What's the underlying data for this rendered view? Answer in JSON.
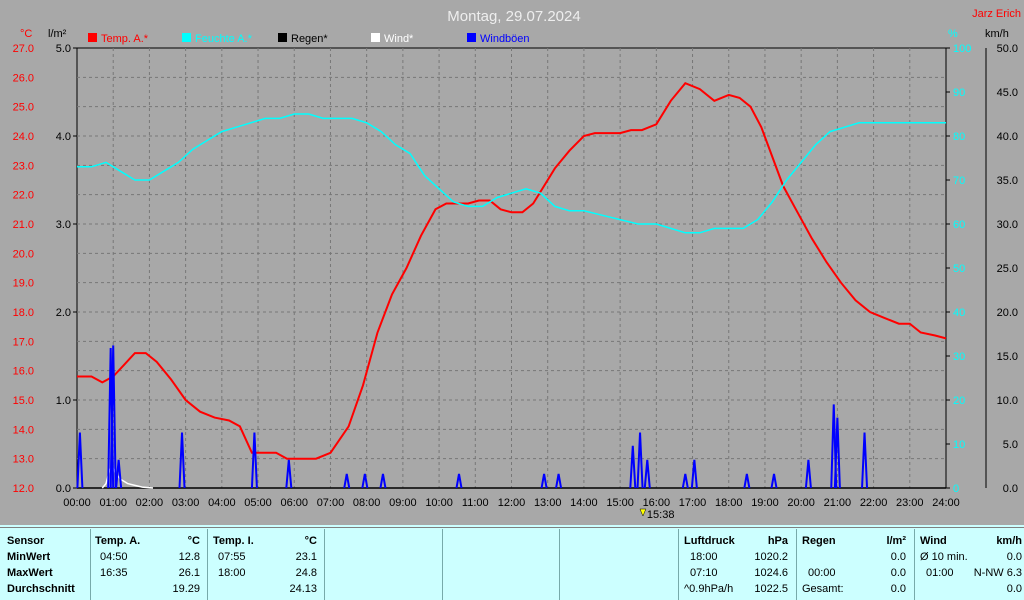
{
  "chart_data": {
    "type": "line",
    "title": "Montag, 29.07.2024",
    "brand": "Jarz Erich",
    "axes": {
      "left_temp": {
        "label": "°C",
        "range": [
          12.0,
          27.0
        ],
        "ticks": [
          "27.0",
          "26.0",
          "25.0",
          "24.0",
          "23.0",
          "22.0",
          "21.0",
          "20.0",
          "19.0",
          "18.0",
          "17.0",
          "16.0",
          "15.0",
          "14.0",
          "13.0",
          "12.0"
        ]
      },
      "left_rain": {
        "label": "l/m²",
        "range": [
          0.0,
          5.0
        ],
        "ticks": [
          "5.0",
          "4.0",
          "3.0",
          "2.0",
          "1.0",
          "0.0"
        ]
      },
      "right_hum": {
        "label": "%",
        "range": [
          0,
          100
        ],
        "ticks": [
          "100",
          "90",
          "80",
          "70",
          "60",
          "50",
          "40",
          "30",
          "20",
          "10",
          "0"
        ]
      },
      "right_wind": {
        "label": "km/h",
        "range": [
          0.0,
          50.0
        ],
        "ticks": [
          "50.0",
          "45.0",
          "40.0",
          "35.0",
          "30.0",
          "25.0",
          "20.0",
          "15.0",
          "10.0",
          "5.0",
          "0.0"
        ]
      },
      "x": {
        "range": [
          0,
          24
        ],
        "ticks": [
          "00:00",
          "01:00",
          "02:00",
          "03:00",
          "04:00",
          "05:00",
          "06:00",
          "07:00",
          "08:00",
          "09:00",
          "10:00",
          "11:00",
          "12:00",
          "13:00",
          "14:00",
          "15:00",
          "16:00",
          "17:00",
          "18:00",
          "19:00",
          "20:00",
          "21:00",
          "22:00",
          "23:00",
          "24:00"
        ]
      }
    },
    "grid": true,
    "marker": {
      "label": "15:38",
      "hour": 15.63
    },
    "legend": [
      {
        "name": "Temp. A.*",
        "color": "#ff0000"
      },
      {
        "name": "Feuchte A.*",
        "color": "#00ffff"
      },
      {
        "name": "Regen*",
        "color": "#000000"
      },
      {
        "name": "Wind*",
        "color": "#ffffff"
      },
      {
        "name": "Windböen",
        "color": "#0000ff"
      }
    ],
    "series": [
      {
        "name": "Temp. A.*",
        "color": "#ff0000",
        "axis": "left_temp",
        "points": [
          [
            0,
            15.8
          ],
          [
            0.4,
            15.8
          ],
          [
            0.7,
            15.6
          ],
          [
            1.0,
            15.8
          ],
          [
            1.3,
            16.2
          ],
          [
            1.6,
            16.6
          ],
          [
            1.9,
            16.6
          ],
          [
            2.2,
            16.3
          ],
          [
            2.6,
            15.7
          ],
          [
            3.0,
            15.0
          ],
          [
            3.4,
            14.6
          ],
          [
            3.8,
            14.4
          ],
          [
            4.2,
            14.3
          ],
          [
            4.5,
            14.1
          ],
          [
            4.83,
            13.2
          ],
          [
            5.2,
            13.2
          ],
          [
            5.5,
            13.2
          ],
          [
            5.8,
            13.0
          ],
          [
            6.2,
            13.0
          ],
          [
            6.6,
            13.0
          ],
          [
            7.0,
            13.2
          ],
          [
            7.5,
            14.1
          ],
          [
            7.9,
            15.5
          ],
          [
            8.3,
            17.3
          ],
          [
            8.7,
            18.6
          ],
          [
            9.1,
            19.5
          ],
          [
            9.5,
            20.6
          ],
          [
            9.9,
            21.5
          ],
          [
            10.2,
            21.7
          ],
          [
            10.5,
            21.7
          ],
          [
            10.8,
            21.7
          ],
          [
            11.1,
            21.8
          ],
          [
            11.4,
            21.8
          ],
          [
            11.7,
            21.5
          ],
          [
            12.0,
            21.4
          ],
          [
            12.3,
            21.4
          ],
          [
            12.6,
            21.7
          ],
          [
            12.9,
            22.3
          ],
          [
            13.2,
            22.9
          ],
          [
            13.6,
            23.5
          ],
          [
            14.0,
            24.0
          ],
          [
            14.3,
            24.1
          ],
          [
            14.6,
            24.1
          ],
          [
            15.0,
            24.1
          ],
          [
            15.3,
            24.2
          ],
          [
            15.6,
            24.2
          ],
          [
            16.0,
            24.4
          ],
          [
            16.4,
            25.2
          ],
          [
            16.8,
            25.8
          ],
          [
            17.2,
            25.6
          ],
          [
            17.6,
            25.2
          ],
          [
            18.0,
            25.4
          ],
          [
            18.3,
            25.3
          ],
          [
            18.6,
            25.0
          ],
          [
            18.9,
            24.3
          ],
          [
            19.2,
            23.3
          ],
          [
            19.5,
            22.3
          ],
          [
            19.9,
            21.4
          ],
          [
            20.3,
            20.5
          ],
          [
            20.7,
            19.7
          ],
          [
            21.1,
            19.0
          ],
          [
            21.5,
            18.4
          ],
          [
            21.9,
            18.0
          ],
          [
            22.3,
            17.8
          ],
          [
            22.7,
            17.6
          ],
          [
            23.0,
            17.6
          ],
          [
            23.3,
            17.3
          ],
          [
            23.7,
            17.2
          ],
          [
            24.0,
            17.1
          ]
        ]
      },
      {
        "name": "Feuchte A.*",
        "color": "#00ffff",
        "axis": "right_hum",
        "points": [
          [
            0,
            73
          ],
          [
            0.4,
            73
          ],
          [
            0.8,
            74
          ],
          [
            1.2,
            72
          ],
          [
            1.6,
            70
          ],
          [
            2.0,
            70
          ],
          [
            2.4,
            72
          ],
          [
            2.8,
            74
          ],
          [
            3.2,
            77
          ],
          [
            3.6,
            79
          ],
          [
            4.0,
            81
          ],
          [
            4.4,
            82
          ],
          [
            4.8,
            83
          ],
          [
            5.2,
            84
          ],
          [
            5.6,
            84
          ],
          [
            6.0,
            85
          ],
          [
            6.4,
            85
          ],
          [
            6.8,
            84
          ],
          [
            7.2,
            84
          ],
          [
            7.6,
            84
          ],
          [
            8.0,
            83
          ],
          [
            8.4,
            81
          ],
          [
            8.8,
            78
          ],
          [
            9.2,
            76
          ],
          [
            9.6,
            71
          ],
          [
            10.0,
            68
          ],
          [
            10.4,
            65
          ],
          [
            10.8,
            64
          ],
          [
            11.2,
            64
          ],
          [
            11.6,
            66
          ],
          [
            12.0,
            67
          ],
          [
            12.4,
            68
          ],
          [
            12.8,
            67
          ],
          [
            13.2,
            64
          ],
          [
            13.6,
            63
          ],
          [
            14.0,
            63
          ],
          [
            14.5,
            62
          ],
          [
            15.0,
            61
          ],
          [
            15.5,
            60
          ],
          [
            16.0,
            60
          ],
          [
            16.4,
            59
          ],
          [
            16.8,
            58
          ],
          [
            17.2,
            58
          ],
          [
            17.6,
            59
          ],
          [
            18.0,
            59
          ],
          [
            18.4,
            59
          ],
          [
            18.8,
            61
          ],
          [
            19.2,
            65
          ],
          [
            19.6,
            70
          ],
          [
            20.0,
            74
          ],
          [
            20.4,
            78
          ],
          [
            20.8,
            81
          ],
          [
            21.2,
            82
          ],
          [
            21.6,
            83
          ],
          [
            22.0,
            83
          ],
          [
            22.4,
            83
          ],
          [
            22.8,
            83
          ],
          [
            23.2,
            83
          ],
          [
            23.6,
            83
          ],
          [
            24.0,
            83
          ]
        ]
      },
      {
        "name": "Regen*",
        "color": "#000000",
        "axis": "left_rain",
        "points": [
          [
            0,
            0
          ],
          [
            24,
            0
          ]
        ]
      },
      {
        "name": "Wind*",
        "color": "#ffffff",
        "axis": "right_wind",
        "points": [
          [
            0.7,
            0
          ],
          [
            0.8,
            0.5
          ],
          [
            0.9,
            2.0
          ],
          [
            0.97,
            2.5
          ],
          [
            1.05,
            1.8
          ],
          [
            1.2,
            1.0
          ],
          [
            1.4,
            0.5
          ],
          [
            1.6,
            0.3
          ],
          [
            1.8,
            0.1
          ],
          [
            2.1,
            0
          ]
        ]
      },
      {
        "name": "Windböen",
        "color": "#0000ff",
        "axis": "right_wind",
        "spikes": [
          [
            0.08,
            6.3
          ],
          [
            0.93,
            15.9
          ],
          [
            1.0,
            16.2
          ],
          [
            1.15,
            3.2
          ],
          [
            2.9,
            6.3
          ],
          [
            4.9,
            6.3
          ],
          [
            5.85,
            3.2
          ],
          [
            7.45,
            1.6
          ],
          [
            7.95,
            1.6
          ],
          [
            8.45,
            1.6
          ],
          [
            10.55,
            1.6
          ],
          [
            12.9,
            1.6
          ],
          [
            13.3,
            1.6
          ],
          [
            15.35,
            4.8
          ],
          [
            15.55,
            6.3
          ],
          [
            15.75,
            3.2
          ],
          [
            16.8,
            1.6
          ],
          [
            17.05,
            3.2
          ],
          [
            18.5,
            1.6
          ],
          [
            19.25,
            1.6
          ],
          [
            20.2,
            3.2
          ],
          [
            20.9,
            9.5
          ],
          [
            21.0,
            8.0
          ],
          [
            21.75,
            6.3
          ]
        ]
      }
    ]
  },
  "panel": {
    "col_sensor": {
      "title": "Sensor",
      "rows": [
        "MinWert",
        "MaxWert",
        "Durchschnitt"
      ]
    },
    "col_temp_a": {
      "title": "Temp. A.",
      "unit": "°C",
      "rows": [
        {
          "time": "04:50",
          "value": "12.8"
        },
        {
          "time": "16:35",
          "value": "26.1"
        },
        {
          "time": "",
          "value": "19.29"
        }
      ]
    },
    "col_temp_i": {
      "title": "Temp. I.",
      "unit": "°C",
      "rows": [
        {
          "time": "07:55",
          "value": "23.1"
        },
        {
          "time": "18:00",
          "value": "24.8"
        },
        {
          "time": "",
          "value": "24.13"
        }
      ]
    },
    "col_luftdruck": {
      "title": "Luftdruck",
      "unit": "hPa",
      "rows": [
        {
          "time": "18:00",
          "value": "1020.2"
        },
        {
          "time": "07:10",
          "value": "1024.6"
        },
        {
          "time": "^0.9hPa/h",
          "value": "1022.5"
        }
      ]
    },
    "col_regen": {
      "title": "Regen",
      "unit": "l/m²",
      "rows": [
        {
          "time": "",
          "value": "0.0"
        },
        {
          "time": "00:00",
          "value": "0.0"
        },
        {
          "time": "Gesamt:",
          "value": "0.0"
        }
      ]
    },
    "col_wind": {
      "title": "Wind",
      "unit": "km/h",
      "rows": [
        {
          "time": "Ø 10 min.",
          "value": "0.0"
        },
        {
          "time": "01:00",
          "value": "N-NW 6.3"
        },
        {
          "time": "",
          "value": "0.0"
        }
      ]
    }
  }
}
